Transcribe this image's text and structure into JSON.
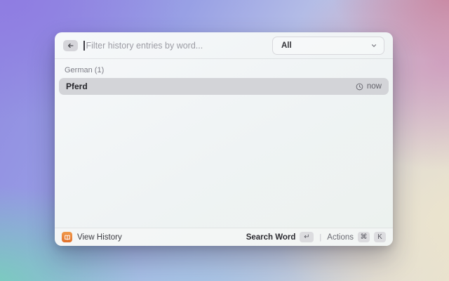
{
  "window": {
    "header": {
      "search_placeholder": "Filter history entries by word...",
      "search_value": "",
      "dropdown": {
        "value": "All"
      }
    },
    "list": {
      "section_title": "German (1)",
      "items": [
        {
          "title": "Pferd",
          "accessory_icon": "clock-icon",
          "accessory_text": "now"
        }
      ]
    },
    "footer": {
      "app_icon": "history-book-icon",
      "app_label": "View History",
      "primary_action": {
        "label": "Search Word",
        "key": "↵"
      },
      "divider": "|",
      "secondary_action": {
        "label": "Actions",
        "key1": "⌘",
        "key2": "K"
      }
    },
    "colors": {
      "accent_orange": "#e8772f",
      "selected_row_bg": "#d3d4d8",
      "bg_purple": "#9089e1",
      "bg_pink": "#cd96ba",
      "bg_cream": "#ebe4ce",
      "bg_teal": "#78d1bb",
      "bg_blue": "#a2c4e6"
    }
  }
}
